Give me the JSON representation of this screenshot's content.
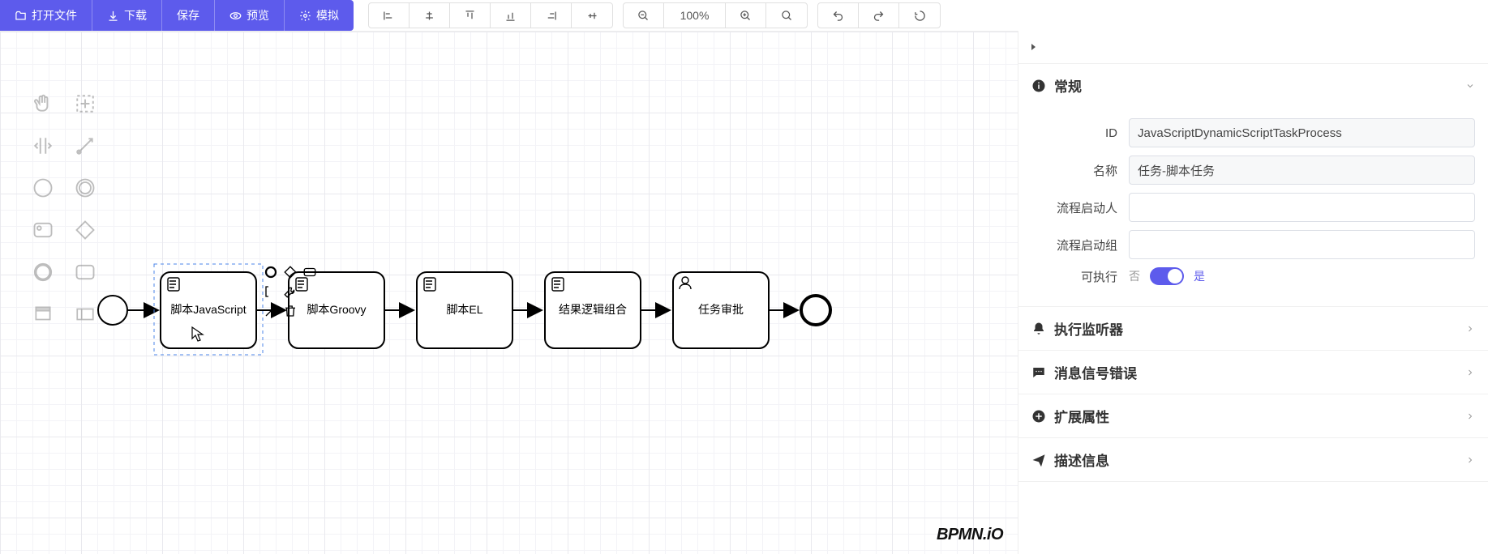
{
  "toolbar": {
    "open": "打开文件",
    "download": "下载",
    "save": "保存",
    "preview": "预览",
    "simulate": "模拟",
    "zoom": "100%"
  },
  "diagram": {
    "startEvent": "",
    "tasks": [
      "脚本JavaScript",
      "脚本Groovy",
      "脚本EL",
      "结果逻辑组合",
      "任务审批"
    ],
    "endEvent": "",
    "logo": "BPMN.iO"
  },
  "properties": {
    "top_collapse_icon": "chevron-right-icon",
    "general": {
      "title": "常规",
      "id_label": "ID",
      "id_value": "JavaScriptDynamicScriptTaskProcess",
      "name_label": "名称",
      "name_value": "任务-脚本任务",
      "initiator_label": "流程启动人",
      "initiator_value": "",
      "initiator_group_label": "流程启动组",
      "initiator_group_value": "",
      "executable_label": "可执行",
      "switch_off": "否",
      "switch_on": "是"
    },
    "sections": {
      "listeners": "执行监听器",
      "signals": "消息信号错误",
      "ext": "扩展属性",
      "desc": "描述信息"
    }
  }
}
